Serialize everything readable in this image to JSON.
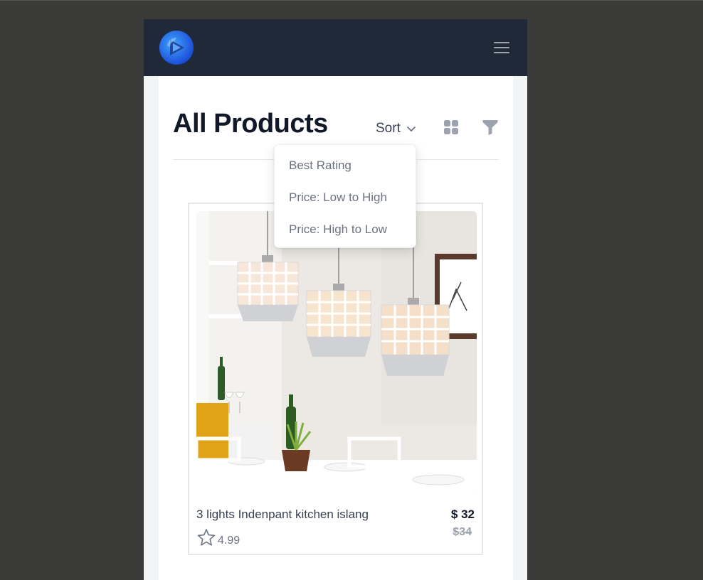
{
  "navbar": {
    "logo_icon": "brand-logo-icon",
    "menu_icon": "hamburger-icon"
  },
  "page": {
    "title": "All Products",
    "sort_label": "Sort",
    "sort_icon": "chevron-down-icon",
    "grid_icon": "grid-view-icon",
    "filter_icon": "filter-icon"
  },
  "sort_menu": {
    "options": [
      "Best Rating",
      "Price: Low to High",
      "Price: High to Low"
    ]
  },
  "product": {
    "name": "3 lights Indenpant kitchen islang",
    "price": "$ 32",
    "old_price": "$34",
    "rating": "4.99",
    "rating_icon": "star-outline-icon",
    "image_subject": "pendant-lights-photo"
  },
  "colors": {
    "navbar_bg": "#1f2937",
    "page_bg": "#f3f4f6",
    "brand_blue": "#2563eb",
    "text_dark": "#111827",
    "text_muted": "#6b7280"
  }
}
